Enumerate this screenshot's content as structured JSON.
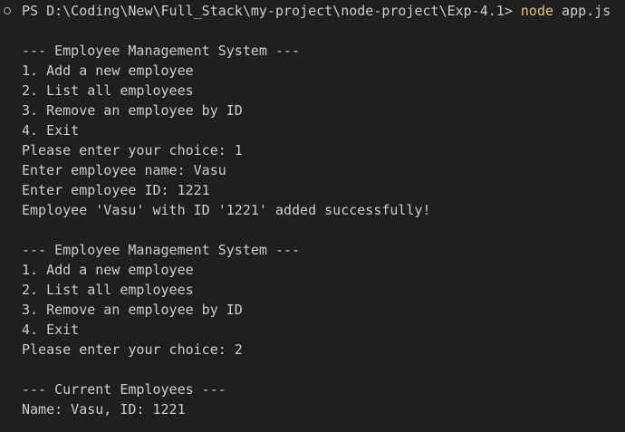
{
  "terminal": {
    "prompt": "PS D:\\Coding\\New\\Full_Stack\\my-project\\node-project\\Exp-4.1> ",
    "command": "node",
    "args": " app.js",
    "lines": [
      "--- Employee Management System ---",
      "1. Add a new employee",
      "2. List all employees",
      "3. Remove an employee by ID",
      "4. Exit",
      "Please enter your choice: 1",
      "Enter employee name: Vasu",
      "Enter employee ID: 1221",
      "Employee 'Vasu' with ID '1221' added successfully!",
      "",
      "--- Employee Management System ---",
      "1. Add a new employee",
      "2. List all employees",
      "3. Remove an employee by ID",
      "4. Exit",
      "Please enter your choice: 2",
      "",
      "--- Current Employees ---",
      "Name: Vasu, ID: 1221"
    ],
    "colors": {
      "background": "#1f1f1f",
      "text": "#cccccc",
      "command": "#e5c07b"
    }
  }
}
